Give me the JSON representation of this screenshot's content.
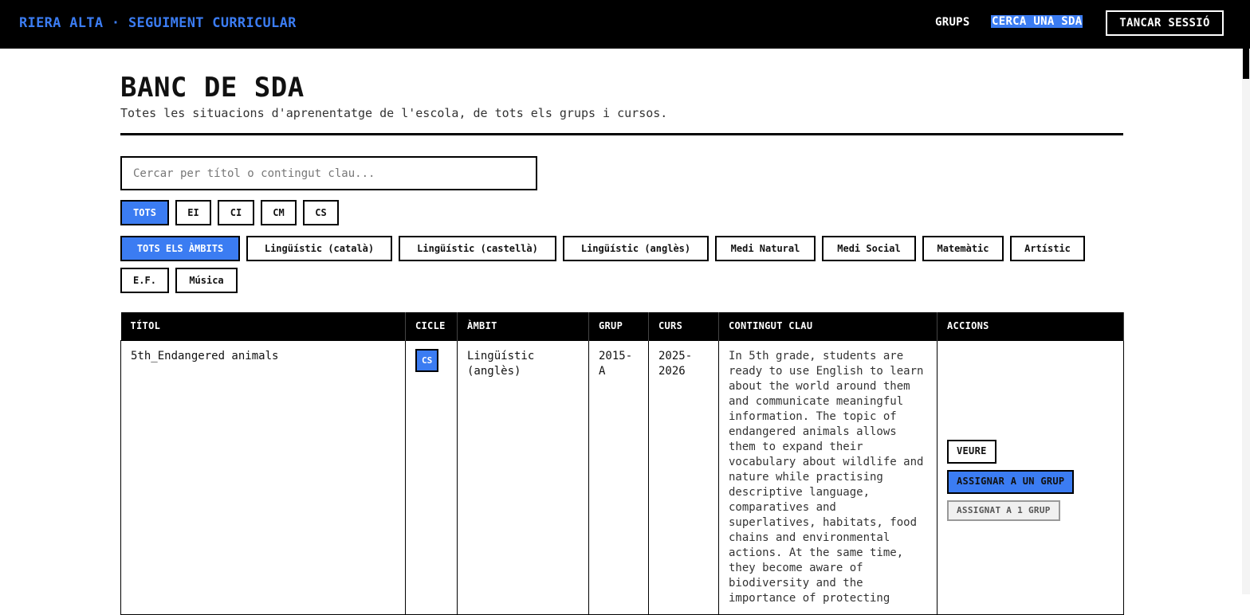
{
  "header": {
    "brand": "RIERA ALTA · SEGUIMENT CURRICULAR",
    "nav": {
      "grups": "GRUPS",
      "cerca": "CERCA UNA SDA",
      "logout": "TANCAR SESSIÓ"
    }
  },
  "page": {
    "title": "BANC DE SDA",
    "subtitle": "Totes les situacions d'aprenentatge de l'escola, de tots els grups i cursos."
  },
  "search": {
    "placeholder": "Cercar per títol o contingut clau...",
    "value": ""
  },
  "cycle_filters": [
    "TOTS",
    "EI",
    "CI",
    "CM",
    "CS"
  ],
  "area_filters": [
    "TOTS ELS ÀMBITS",
    "Lingüístic (català)",
    "Lingüístic (castellà)",
    "Lingüístic (anglès)",
    "Medi Natural",
    "Medi Social",
    "Matemàtic",
    "Artístic",
    "E.F.",
    "Música"
  ],
  "table": {
    "headers": [
      "TÍTOL",
      "CICLE",
      "ÀMBIT",
      "GRUP",
      "CURS",
      "CONTINGUT CLAU",
      "ACCIONS"
    ],
    "rows": [
      {
        "title": "5th_Endangered animals",
        "cycle": "CS",
        "area": "Lingüístic (anglès)",
        "group": "2015-A",
        "course": "2025-2026",
        "content": "In 5th grade, students are ready to use English to learn about the world around them and communicate meaningful information. The topic of endangered animals allows them to expand their vocabulary about wildlife and nature while practising descriptive language, comparatives and superlatives, habitats, food chains and environmental actions. At the same time, they become aware of biodiversity and the importance of protecting",
        "actions": {
          "view": "VEURE",
          "assign": "ASSIGNAR A UN GRUP",
          "assigned": "ASSIGNAT A 1 GRUP"
        }
      }
    ]
  },
  "colors": {
    "accent": "#3b7cf2",
    "bar": "#000000"
  }
}
